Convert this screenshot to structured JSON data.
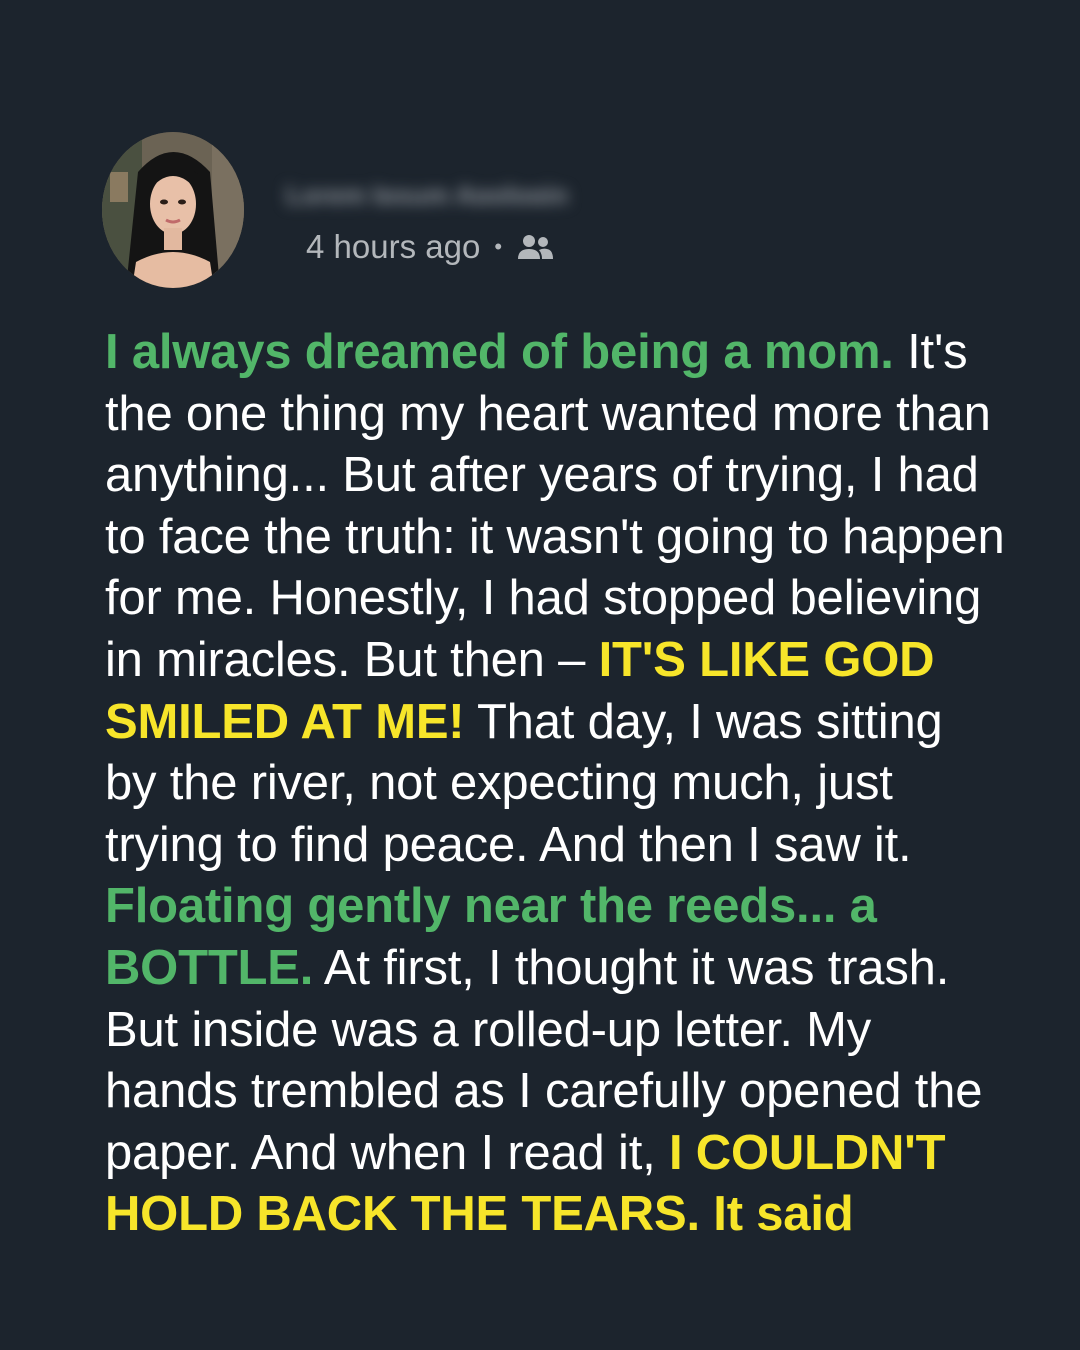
{
  "post": {
    "author_name": "Lorem Ipsum Apologin",
    "timestamp": "4 hours ago",
    "separator": "•",
    "audience_icon": "friends-icon"
  },
  "colors": {
    "background": "#1c242d",
    "text": "#ffffff",
    "accent_green": "#52b669",
    "accent_yellow": "#f7e52a",
    "meta": "#b3b7bb"
  },
  "story": {
    "p1_green": "I always dreamed of being a mom.",
    "p2": " It's the one thing my heart wanted more than anything... But after years of trying, I had to face the truth: it wasn't going to happen for me. Honestly, I had stopped believing in miracles. But then – ",
    "p3_yellow": "IT'S LIKE GOD SMILED AT ME!",
    "p4": " That day, I was sitting by the river, not expecting much, just trying to find peace. And then I saw it. ",
    "p5_green": "Floating gently near the reeds... a BOTTLE.",
    "p6": " At first, I thought it was trash. But inside was a rolled-up letter. My hands trembled as I carefully opened the paper. And when I read it, ",
    "p7_yellow": "I COULDN'T HOLD BACK THE TEARS.",
    "p8_yellow": " It said"
  }
}
